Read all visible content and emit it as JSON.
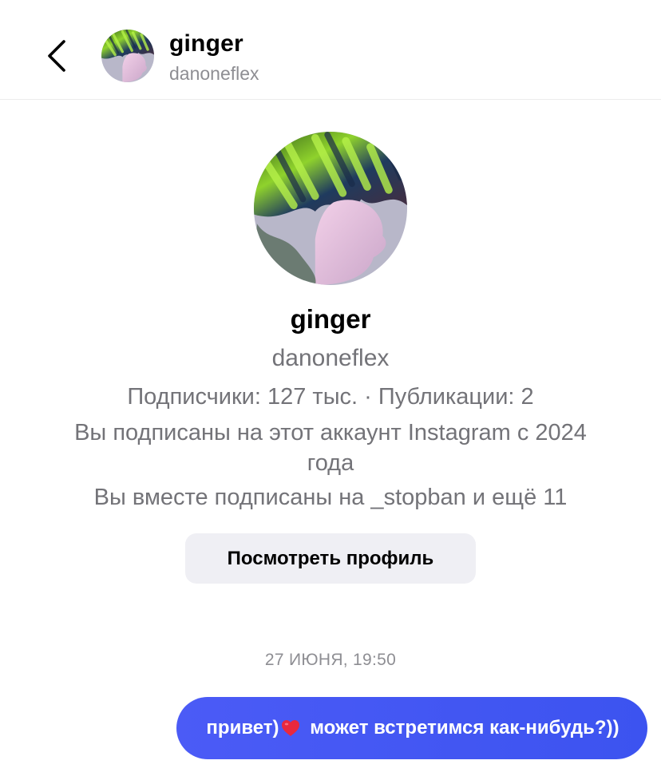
{
  "header": {
    "name": "ginger",
    "username": "danoneflex",
    "back_icon": "chevron-left-icon"
  },
  "profile": {
    "name": "ginger",
    "username": "danoneflex",
    "stats": "Подписчики: 127 тыс. · Публикации: 2",
    "follow_since": "Вы подписаны на этот аккаунт Instagram с 2024 года",
    "mutual": "Вы вместе подписаны на _stopban и ещё 11",
    "view_profile_label": "Посмотреть профиль"
  },
  "conversation": {
    "timestamp": "27 ИЮНЯ, 19:50",
    "messages": [
      {
        "text_before": "привет)",
        "emoji": "heart-icon",
        "text_after": " может встретимся как-нибудь?))",
        "from_me": true
      }
    ]
  },
  "colors": {
    "bubble": "#3f55f2",
    "secondary_text": "#737378",
    "button_bg": "#efeff4"
  }
}
